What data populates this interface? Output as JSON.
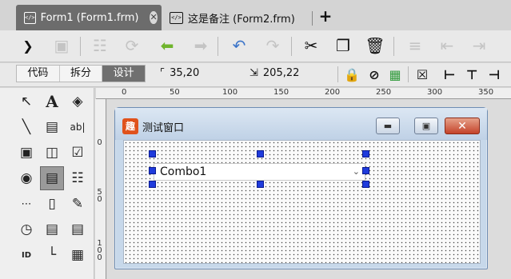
{
  "tabs": [
    {
      "label": "Form1 (Form1.frm)",
      "icon": "code-file-icon",
      "active": true
    },
    {
      "label": "这是备注 (Form2.frm)",
      "icon": "code-file-icon",
      "active": false
    }
  ],
  "tab_close_glyph": "✕",
  "new_tab_glyph": "+",
  "view_modes": [
    "代码",
    "拆分",
    "设计"
  ],
  "selected_view_mode": "设计",
  "position": "35,20",
  "size": "205,22",
  "ruler": {
    "h_ticks": [
      "0",
      "50",
      "100",
      "150",
      "200",
      "250",
      "300",
      "350"
    ],
    "v_ticks": [
      "0",
      "50",
      "100"
    ]
  },
  "toolbox_icons": [
    "pointer-icon",
    "label-icon",
    "shapes-icon",
    "line-icon",
    "image-icon",
    "textbox-icon",
    "button-icon",
    "frame-icon",
    "checkbox-icon",
    "radio-icon",
    "combobox-icon",
    "listbox-icon",
    "hscrollbar-icon",
    "vscrollbar-icon",
    "pen-icon",
    "timer-icon",
    "drive-list-icon",
    "file-list-icon",
    "id-icon",
    "chart-icon",
    "grid-icon"
  ],
  "form": {
    "title": "测试窗口",
    "icon_text": "趣",
    "combo_text": "Combo1",
    "accent_color": "#1f3bdc"
  }
}
